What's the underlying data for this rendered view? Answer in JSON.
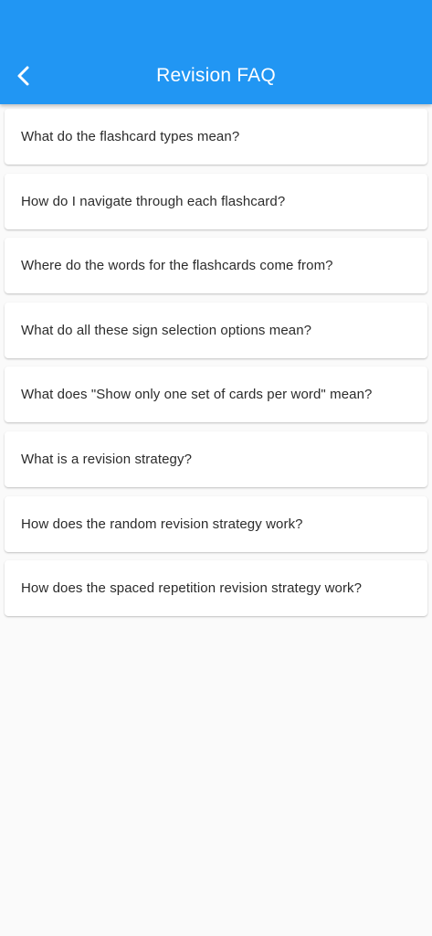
{
  "app_bar": {
    "title": "Revision FAQ",
    "back_icon": "chevron-left-icon",
    "color": "#2196f3"
  },
  "faq": {
    "items": [
      "What do the flashcard types mean?",
      "How do I navigate through each flashcard?",
      "Where do the words for the flashcards come from?",
      "What do all these sign selection options mean?",
      "What does \"Show only one set of cards per word\" mean?",
      "What is a revision strategy?",
      "How does the random revision strategy work?",
      "How does the spaced repetition revision strategy work?"
    ]
  }
}
